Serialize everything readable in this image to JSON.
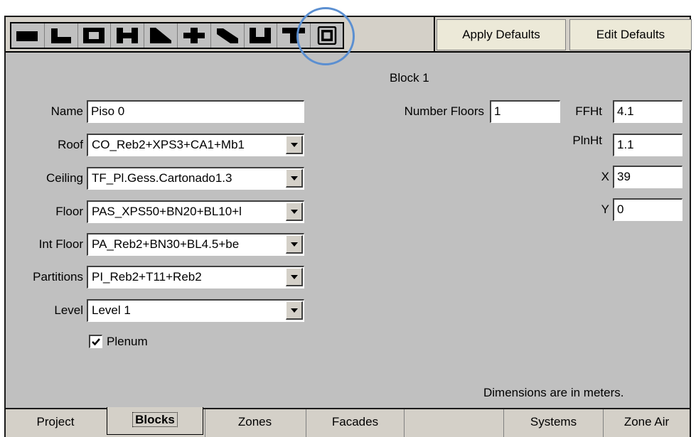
{
  "toolbar": {
    "shapes": [
      {
        "icon": "rectangle-block-icon"
      },
      {
        "icon": "l-shape-block-icon"
      },
      {
        "icon": "courtyard-block-icon"
      },
      {
        "icon": "h-shape-block-icon"
      },
      {
        "icon": "chamfer-block-icon"
      },
      {
        "icon": "cross-block-icon"
      },
      {
        "icon": "angled-block-icon"
      },
      {
        "icon": "u-shape-block-icon"
      },
      {
        "icon": "t-shape-block-icon"
      },
      {
        "icon": "atrium-block-icon"
      }
    ],
    "apply_defaults": "Apply Defaults",
    "edit_defaults": "Edit Defaults"
  },
  "block": {
    "title": "Block 1",
    "name_label": "Name",
    "name_value": "Piso 0",
    "roof_label": "Roof",
    "roof_value": "CO_Reb2+XPS3+CA1+Mb1",
    "ceiling_label": "Ceiling",
    "ceiling_value": "TF_Pl.Gess.Cartonado1.3",
    "floor_label": "Floor",
    "floor_value": "PAS_XPS50+BN20+BL10+l",
    "int_floor_label": "Int Floor",
    "int_floor_value": "PA_Reb2+BN30+BL4.5+be",
    "partitions_label": "Partitions",
    "partitions_value": "PI_Reb2+T11+Reb2",
    "level_label": "Level",
    "level_value": "Level 1",
    "plenum_label": "Plenum",
    "plenum_checked": true,
    "number_floors_label": "Number Floors",
    "number_floors_value": "1",
    "ffht_label": "FFHt",
    "ffht_value": "4.1",
    "plnht_label": "PlnHt",
    "plnht_value": "1.1",
    "x_label": "X",
    "x_value": "39",
    "y_label": "Y",
    "y_value": "0",
    "units_note": "Dimensions are in meters."
  },
  "tabs": [
    {
      "label": "Project",
      "active": false
    },
    {
      "label": "Blocks",
      "active": true
    },
    {
      "label": "Zones",
      "active": false
    },
    {
      "label": "Facades",
      "active": false
    },
    {
      "label": "Systems",
      "active": false
    },
    {
      "label": "Zone Air",
      "active": false
    }
  ],
  "colors": {
    "panel": "#c0c0c0",
    "highlight_ring": "#5b8fd1"
  }
}
